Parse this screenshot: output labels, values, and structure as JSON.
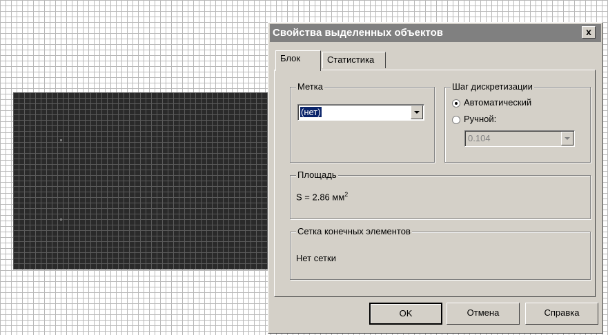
{
  "dialog": {
    "title": "Свойства выделенных объектов",
    "close_label": "x"
  },
  "tabs": [
    {
      "label": "Блок",
      "active": true
    },
    {
      "label": "Статистика",
      "active": false
    }
  ],
  "label_group": {
    "title": "Метка",
    "selected_value": "(нет)"
  },
  "sampling_group": {
    "title": "Шаг дискретизации",
    "options": [
      {
        "label": "Автоматический",
        "selected": true
      },
      {
        "label": "Ручной:",
        "selected": false
      }
    ],
    "manual_value": "0.104"
  },
  "area_group": {
    "title": "Площадь",
    "value_prefix": "S = 2.86 мм",
    "value_sup": "2"
  },
  "mesh_group": {
    "title": "Сетка конечных элементов",
    "status": "Нет сетки"
  },
  "buttons": {
    "ok": "OK",
    "cancel": "Отмена",
    "help": "Справка"
  },
  "colors": {
    "block_fill": "#2a2a2a",
    "grid_line": "#b8b8b8",
    "dialog_face": "#d4d0c8",
    "titlebar_inactive": "#808080",
    "selection": "#0a246a"
  }
}
